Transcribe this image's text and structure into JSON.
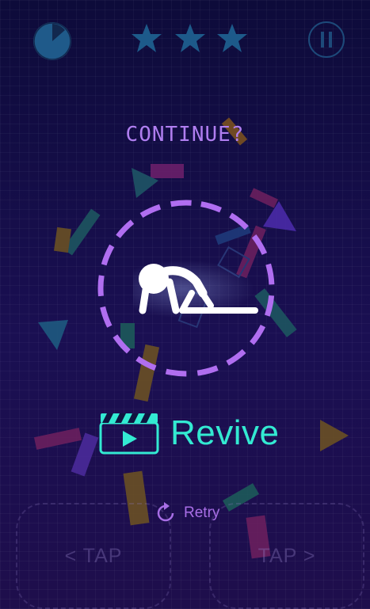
{
  "hud": {
    "timer_icon": "pie-timer-icon",
    "stars_count": 3,
    "pause_icon": "pause-icon"
  },
  "dialog": {
    "title": "CONTINUE?",
    "revive_label": "Revive",
    "revive_icon": "video-clapper-icon",
    "retry_label": "Retry",
    "retry_icon": "retry-icon"
  },
  "controls": {
    "left_tap": "< TAP",
    "right_tap": "TAP >"
  },
  "colors": {
    "accent_cyan": "#33ead2",
    "accent_purple": "#b07ef0",
    "star_blue": "#1d5a8a"
  }
}
